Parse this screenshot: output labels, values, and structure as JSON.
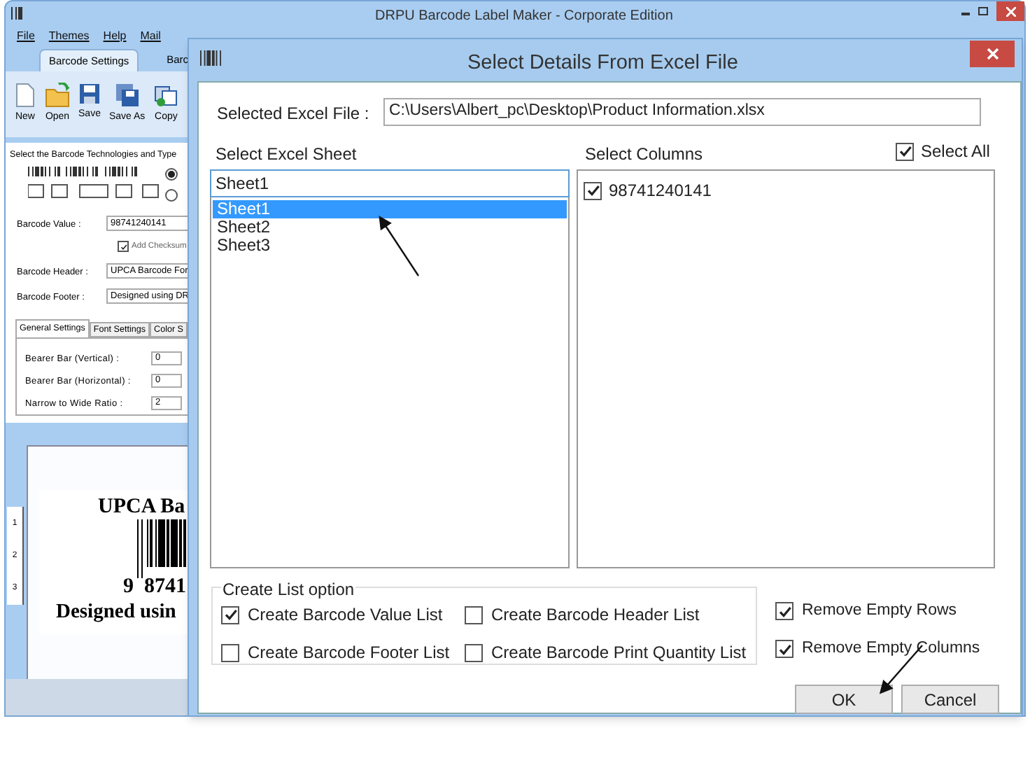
{
  "app": {
    "title": "DRPU Barcode Label Maker - Corporate Edition",
    "menu": [
      "File",
      "Themes",
      "Help",
      "Mail"
    ],
    "tabs": [
      {
        "label": "Barcode Settings",
        "selected": true
      },
      {
        "label": "Barc",
        "selected": false
      }
    ],
    "toolbar": [
      "New",
      "Open",
      "Save",
      "Save As",
      "Copy"
    ],
    "technologies_label": "Select the Barcode Technologies and Type",
    "radios": [
      {
        "selected": true
      },
      {
        "selected": false
      }
    ],
    "fields": [
      {
        "label": "Barcode Value :",
        "value": "98741240141"
      },
      {
        "label": "Barcode Header :",
        "value": "UPCA Barcode For"
      },
      {
        "label": "Barcode Footer :",
        "value": "Designed using DR"
      }
    ],
    "add_checksum": {
      "label": "Add Checksum",
      "checked": true
    },
    "settings_tabs": [
      {
        "label": "General Settings",
        "selected": true
      },
      {
        "label": "Font Settings",
        "selected": false
      },
      {
        "label": "Color S",
        "selected": false
      }
    ],
    "settings": [
      {
        "label": "Bearer Bar (Vertical) :",
        "value": "0"
      },
      {
        "label": "Bearer Bar (Horizontal) :",
        "value": "0"
      },
      {
        "label": "Narrow to Wide Ratio :",
        "value": "2"
      }
    ],
    "ruler": [
      "1",
      "2",
      "3"
    ],
    "preview": {
      "header": "UPCA Ba",
      "digits": "9  8741",
      "footer": "Designed usin"
    }
  },
  "dialog": {
    "title": "Select Details From Excel File",
    "file_label": "Selected Excel File :",
    "file_value": "C:\\Users\\Albert_pc\\Desktop\\Product Information.xlsx",
    "sheet_label": "Select Excel Sheet",
    "sheet_combo": "Sheet1",
    "sheets": [
      {
        "label": "Sheet1",
        "selected": true
      },
      {
        "label": "Sheet2",
        "selected": false
      },
      {
        "label": "Sheet3",
        "selected": false
      }
    ],
    "columns_label": "Select  Columns",
    "select_all": {
      "label": "Select All",
      "checked": true
    },
    "columns": [
      {
        "label": "98741240141",
        "checked": true
      }
    ],
    "create_list": {
      "title": "Create List option",
      "options": [
        {
          "label": "Create Barcode Value List",
          "checked": true
        },
        {
          "label": "Create Barcode Header List",
          "checked": false
        },
        {
          "label": "Create Barcode Footer List",
          "checked": false
        },
        {
          "label": "Create Barcode Print Quantity List",
          "checked": false
        }
      ]
    },
    "remove_options": [
      {
        "label": "Remove Empty Rows",
        "checked": true
      },
      {
        "label": "Remove Empty Columns",
        "checked": true
      }
    ],
    "buttons": [
      "OK",
      "Cancel"
    ]
  }
}
